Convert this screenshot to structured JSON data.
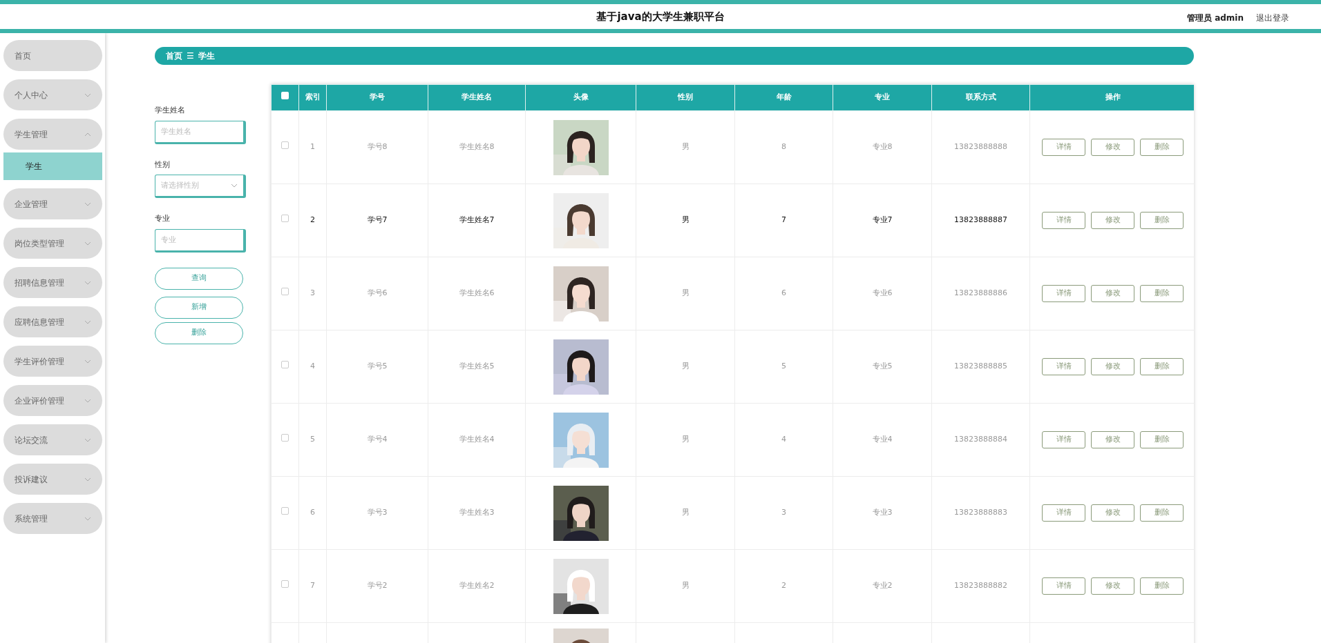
{
  "header": {
    "title": "基于java的大学生兼职平台",
    "user": "管理员 admin",
    "logout": "退出登录"
  },
  "sidebar": {
    "items": [
      {
        "label": "首页",
        "has_children": false
      },
      {
        "label": "个人中心",
        "has_children": true,
        "expanded": false
      },
      {
        "label": "学生管理",
        "has_children": true,
        "expanded": true,
        "children": [
          {
            "label": "学生",
            "selected": true
          }
        ]
      },
      {
        "label": "企业管理",
        "has_children": true,
        "expanded": false
      },
      {
        "label": "岗位类型管理",
        "has_children": true,
        "expanded": false
      },
      {
        "label": "招聘信息管理",
        "has_children": true,
        "expanded": false
      },
      {
        "label": "应聘信息管理",
        "has_children": true,
        "expanded": false
      },
      {
        "label": "学生评价管理",
        "has_children": true,
        "expanded": false
      },
      {
        "label": "企业评价管理",
        "has_children": true,
        "expanded": false
      },
      {
        "label": "论坛交流",
        "has_children": true,
        "expanded": false
      },
      {
        "label": "投诉建议",
        "has_children": true,
        "expanded": false
      },
      {
        "label": "系统管理",
        "has_children": true,
        "expanded": false
      }
    ]
  },
  "breadcrumb": {
    "items": [
      "首页",
      "学生"
    ],
    "separator": "☰"
  },
  "filters": [
    {
      "kind": "input",
      "label": "学生姓名",
      "placeholder": "学生姓名"
    },
    {
      "kind": "select",
      "label": "性别",
      "placeholder": "请选择性别"
    },
    {
      "kind": "input",
      "label": "专业",
      "placeholder": "专业"
    }
  ],
  "actions": [
    "查询",
    "新增",
    "删除"
  ],
  "table": {
    "select_all_checked": false,
    "columns": [
      "索引",
      "学号",
      "学生姓名",
      "头像",
      "性别",
      "年龄",
      "专业",
      "联系方式",
      "操作"
    ],
    "rows": [
      {
        "kind": "full",
        "checked": false,
        "hovered": false,
        "cells": [
          "1",
          "学号8",
          "学生姓名8",
          "男",
          "8",
          "专业8",
          "13823888888"
        ],
        "actions": [
          "详情",
          "修改",
          "删除"
        ],
        "avatar": {
          "kind": "picture"
        }
      },
      {
        "kind": "full",
        "checked": false,
        "hovered": true,
        "cells": [
          "2",
          "学号7",
          "学生姓名7",
          "男",
          "7",
          "专业7",
          "13823888887"
        ],
        "actions": [
          "详情",
          "修改",
          "删除"
        ],
        "avatar": {
          "kind": "picture"
        }
      },
      {
        "kind": "full",
        "checked": false,
        "hovered": false,
        "cells": [
          "3",
          "学号6",
          "学生姓名6",
          "男",
          "6",
          "专业6",
          "13823888886"
        ],
        "actions": [
          "详情",
          "修改",
          "删除"
        ],
        "avatar": {
          "kind": "picture"
        }
      },
      {
        "kind": "full",
        "checked": false,
        "hovered": false,
        "cells": [
          "4",
          "学号5",
          "学生姓名5",
          "男",
          "5",
          "专业5",
          "13823888885"
        ],
        "actions": [
          "详情",
          "修改",
          "删除"
        ],
        "avatar": {
          "kind": "picture"
        }
      },
      {
        "kind": "full",
        "checked": false,
        "hovered": false,
        "cells": [
          "5",
          "学号4",
          "学生姓名4",
          "男",
          "4",
          "专业4",
          "13823888884"
        ],
        "actions": [
          "详情",
          "修改",
          "删除"
        ],
        "avatar": {
          "kind": "picture"
        }
      },
      {
        "kind": "full",
        "checked": false,
        "hovered": false,
        "cells": [
          "6",
          "学号3",
          "学生姓名3",
          "男",
          "3",
          "专业3",
          "13823888883"
        ],
        "actions": [
          "详情",
          "修改",
          "删除"
        ],
        "avatar": {
          "kind": "picture"
        }
      },
      {
        "kind": "full",
        "checked": false,
        "hovered": false,
        "cells": [
          "7",
          "学号2",
          "学生姓名2",
          "男",
          "2",
          "专业2",
          "13823888882"
        ],
        "actions": [
          "详情",
          "修改",
          "删除"
        ],
        "avatar": {
          "kind": "picture"
        }
      },
      {
        "kind": "cut",
        "avatar": {
          "kind": "picture"
        }
      }
    ]
  }
}
